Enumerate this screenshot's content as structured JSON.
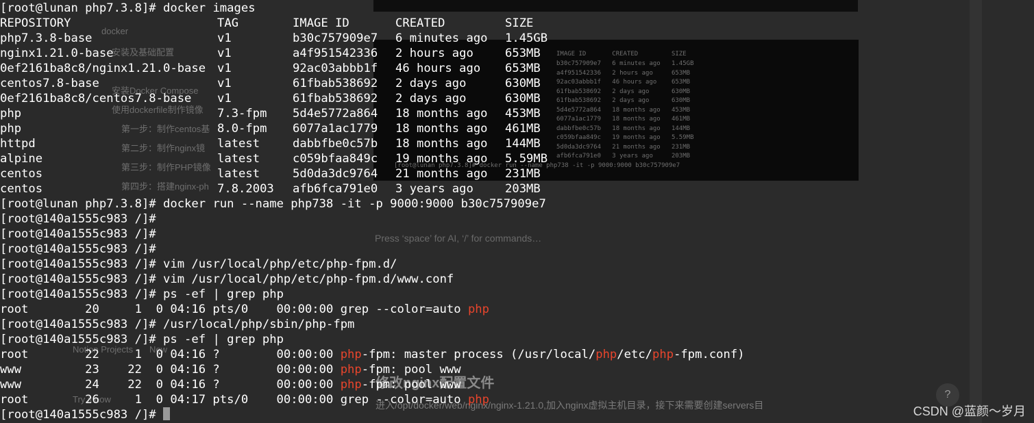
{
  "terminal": {
    "prompt_host": "[root@lunan php7.3.8]#",
    "prompt_container": "[root@140a1555c983 /]#",
    "cmd_images": "docker images",
    "headers": [
      "REPOSITORY",
      "TAG",
      "IMAGE ID",
      "CREATED",
      "SIZE"
    ],
    "images": [
      [
        "php7.3.8-base",
        "v1",
        "b30c757909e7",
        "6 minutes ago",
        "1.45GB"
      ],
      [
        "nginx1.21.0-base",
        "v1",
        "a4f951542336",
        "2 hours ago",
        "653MB"
      ],
      [
        "0ef2161ba8c8/nginx1.21.0-base",
        "v1",
        "92ac03abbb1f",
        "46 hours ago",
        "653MB"
      ],
      [
        "centos7.8-base",
        "v1",
        "61fbab538692",
        "2 days ago",
        "630MB"
      ],
      [
        "0ef2161ba8c8/centos7.8-base",
        "v1",
        "61fbab538692",
        "2 days ago",
        "630MB"
      ],
      [
        "php",
        "7.3-fpm",
        "5d4e5772a864",
        "18 months ago",
        "453MB"
      ],
      [
        "php",
        "8.0-fpm",
        "6077a1ac1779",
        "18 months ago",
        "461MB"
      ],
      [
        "httpd",
        "latest",
        "dabbfbe0c57b",
        "18 months ago",
        "144MB"
      ],
      [
        "alpine",
        "latest",
        "c059bfaa849c",
        "19 months ago",
        "5.59MB"
      ],
      [
        "centos",
        "latest",
        "5d0da3dc9764",
        "21 months ago",
        "231MB"
      ],
      [
        "centos",
        "7.8.2003",
        "afb6fca791e0",
        "3 years ago",
        "203MB"
      ]
    ],
    "cmd_run": "docker run --name php738 -it -p 9000:9000 b30c757909e7",
    "cmd_vim1": "vim /usr/local/php/etc/php-fpm.d/",
    "cmd_vim2": "vim /usr/local/php/etc/php-fpm.d/www.conf",
    "cmd_ps": "ps -ef | grep php",
    "cmd_fpm": "/usr/local/php/sbin/php-fpm",
    "ps1": {
      "fields": "root        20     1  0 04:16 pts/0    00:00:00 grep --color=auto ",
      "match": "php"
    },
    "ps2": [
      {
        "fields": "root        22     1  0 04:16 ?        00:00:00 ",
        "a": "php",
        "b": "-fpm: master process (/usr/local/",
        "c": "php",
        "d": "/etc/",
        "e": "php",
        "f": "-fpm.conf)"
      },
      {
        "fields": "www         23    22  0 04:16 ?        00:00:00 ",
        "a": "php",
        "b": "-fpm: pool www"
      },
      {
        "fields": "www         24    22  0 04:16 ?        00:00:00 ",
        "a": "php",
        "b": "-fpm: pool www"
      },
      {
        "fields": "root        26     1  0 04:17 pts/0    00:00:00 grep --color=auto ",
        "a": "php"
      }
    ]
  },
  "background": {
    "tree": [
      "docker",
      "安装及基础配置",
      "安装Docker Compose",
      "使用dockerfile制作镜像",
      "第一步：制作centos基",
      "第二步：制作nginx镜",
      "第三步：制作PHP镜像",
      "第四步：搭建nginx-ph",
      "Notion Projects",
      "New",
      "Try it now"
    ],
    "hint": "Press ‘space’ for AI, ‘/’ for commands…",
    "heading": "修改nginx配置文件",
    "paragraph": "进入/opt/docker/web/nginx/nginx-1.21.0,加入nginx虚拟主机目录，接下来需要创建servers目",
    "help": "?",
    "mini_header": "IMAGE ID       CREATED         SIZE",
    "mini_rows": [
      "b30c757909e7   6 minutes ago   1.45GB",
      "a4f951542336   2 hours ago     653MB",
      "92ac03abbb1f   46 hours ago    653MB",
      "61fbab538692   2 days ago      630MB",
      "61fbab538692   2 days ago      630MB",
      "5d4e5772a864   18 months ago   453MB",
      "6077a1ac1779   18 months ago   461MB",
      "dabbfbe0c57b   18 months ago   144MB",
      "c059bfaa849c   19 months ago   5.59MB",
      "5d0da3dc9764   21 months ago   231MB",
      "afb6fca791e0   3 years ago     203MB"
    ],
    "mini_cmd": "[root@lunan php7.3.8]# docker run --name php738 -it -p 9000:9000 b30c757909e7"
  },
  "watermark": "CSDN @蓝颜～岁月"
}
